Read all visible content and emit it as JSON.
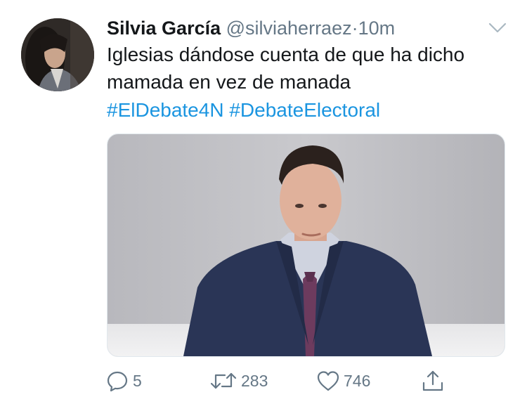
{
  "tweet": {
    "author_name": "Silvia García",
    "handle": "@silviaherraez",
    "separator": "·",
    "time": "10m",
    "text_line1": "Iglesias dándose cuenta de que ha dicho",
    "text_line2": "mamada en vez de manada",
    "hashtags": [
      "#ElDebate4N",
      "#DebateElectoral"
    ]
  },
  "actions": {
    "replies": "5",
    "retweets": "283",
    "likes": "746"
  },
  "colors": {
    "text": "#14171a",
    "secondary": "#657786",
    "link": "#1b95e0"
  },
  "icons": [
    "caret-down-icon",
    "reply-icon",
    "retweet-icon",
    "like-icon",
    "share-icon"
  ]
}
